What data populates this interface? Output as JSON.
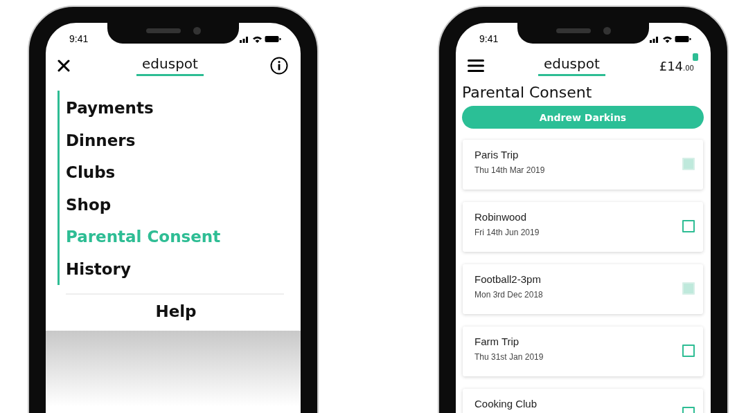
{
  "phones": [
    {
      "kind": "menu",
      "status_time": "9:41",
      "logo": "eduspot",
      "menu_items": [
        {
          "label": "Payments",
          "selected": false
        },
        {
          "label": "Dinners",
          "selected": false
        },
        {
          "label": "Clubs",
          "selected": false
        },
        {
          "label": "Shop",
          "selected": false
        },
        {
          "label": "Parental Consent",
          "selected": true
        },
        {
          "label": "History",
          "selected": false
        }
      ],
      "help": "Help"
    },
    {
      "kind": "consent",
      "status_time": "9:41",
      "logo": "eduspot",
      "balance": "£14$_{.00}$",
      "title": "Parental Consent",
      "child_button": "Andrew Darkins",
      "consents": [
        {
          "title": "Paris Trip",
          "date": "Thu 14th Mar 2019",
          "checked": true
        },
        {
          "title": "Robinwood",
          "date": "Fri 14th Jun 2019",
          "checked": false
        },
        {
          "title": "Football2-3pm",
          "date": "Mon 3rd Dec 2018",
          "checked": true
        },
        {
          "title": "Farm Trip",
          "date": "Thu 31st Jan 2019",
          "checked": false
        },
        {
          "title": "Cooking Club",
          "checked": false
        }
      ]
    }
  ]
}
